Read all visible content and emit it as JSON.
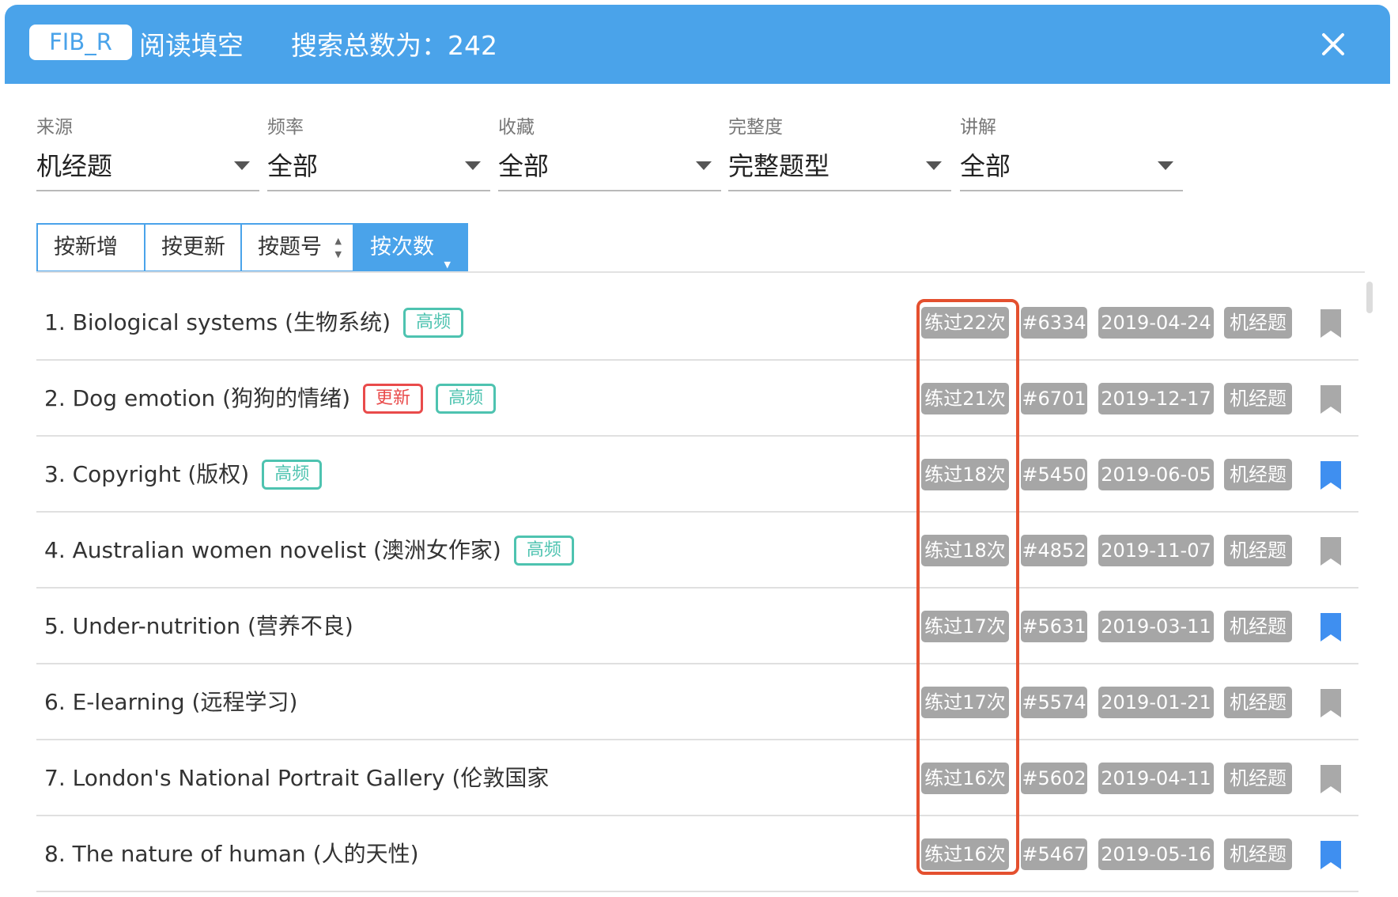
{
  "header": {
    "badge": "FIB_R",
    "title": "阅读填空",
    "count_text": "搜索总数为：242"
  },
  "filters": [
    {
      "label": "来源",
      "value": "机经题"
    },
    {
      "label": "频率",
      "value": "全部"
    },
    {
      "label": "收藏",
      "value": "全部"
    },
    {
      "label": "完整度",
      "value": "完整题型"
    },
    {
      "label": "讲解",
      "value": "全部"
    }
  ],
  "sort": {
    "buttons": [
      "按新增",
      "按更新",
      "按题号",
      "按次数"
    ],
    "active": "按次数"
  },
  "items": [
    {
      "title": "1. Biological systems (生物系统)",
      "tags": [
        "高频"
      ],
      "practice": "练过22次",
      "id": "#6334",
      "date": "2019-04-24",
      "source": "机经题",
      "bookmarked": false
    },
    {
      "title": "2. Dog emotion (狗狗的情绪)",
      "tags": [
        "更新",
        "高频"
      ],
      "practice": "练过21次",
      "id": "#6701",
      "date": "2019-12-17",
      "source": "机经题",
      "bookmarked": false
    },
    {
      "title": "3. Copyright (版权)",
      "tags": [
        "高频"
      ],
      "practice": "练过18次",
      "id": "#5450",
      "date": "2019-06-05",
      "source": "机经题",
      "bookmarked": true
    },
    {
      "title": "4. Australian women novelist (澳洲女作家)",
      "tags": [
        "高频"
      ],
      "practice": "练过18次",
      "id": "#4852",
      "date": "2019-11-07",
      "source": "机经题",
      "bookmarked": false
    },
    {
      "title": "5. Under-nutrition (营养不良)",
      "tags": [],
      "practice": "练过17次",
      "id": "#5631",
      "date": "2019-03-11",
      "source": "机经题",
      "bookmarked": true
    },
    {
      "title": "6. E-learning (远程学习)",
      "tags": [],
      "practice": "练过17次",
      "id": "#5574",
      "date": "2019-01-21",
      "source": "机经题",
      "bookmarked": false
    },
    {
      "title": "7. London's National Portrait Gallery (伦敦国家",
      "tags": [],
      "practice": "练过16次",
      "id": "#5602",
      "date": "2019-04-11",
      "source": "机经题",
      "bookmarked": false
    },
    {
      "title": "8. The nature of human (人的天性)",
      "tags": [],
      "practice": "练过16次",
      "id": "#5467",
      "date": "2019-05-16",
      "source": "机经题",
      "bookmarked": true
    }
  ],
  "colors": {
    "header_bg": "#4aa3ea",
    "freq_tag": "#4ec3b0",
    "update_tag": "#e94b4b",
    "chip_bg": "#a6a6a6",
    "bookmark_on": "#3f8ff0",
    "bookmark_off": "#a9a9a9",
    "highlight": "#e4502f"
  },
  "icons": {
    "close": "close-icon",
    "dropdown": "caret-down-icon",
    "bookmark": "bookmark-icon",
    "sort": "sort-arrows-icon"
  }
}
